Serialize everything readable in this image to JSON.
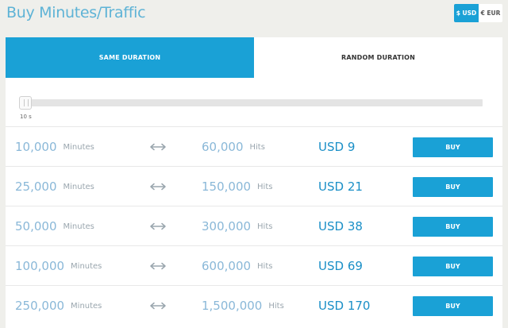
{
  "header": {
    "title": "Buy Minutes/Traffic"
  },
  "currency": {
    "usd_label": "$ USD",
    "eur_label": "€ EUR",
    "selected": "USD"
  },
  "tabs": [
    {
      "label": "SAME DURATION",
      "active": true
    },
    {
      "label": "RANDOM DURATION",
      "active": false
    }
  ],
  "slider": {
    "value_label": "10 s",
    "value": 10
  },
  "colors": {
    "accent": "#1aa1d6",
    "number": "#8ab8d8",
    "price": "#1a8fc7"
  },
  "rows": [
    {
      "minutes": "10,000",
      "minutes_unit": "Minutes",
      "hits": "60,000",
      "hits_unit": "Hits",
      "price": "USD 9",
      "buy_label": "BUY"
    },
    {
      "minutes": "25,000",
      "minutes_unit": "Minutes",
      "hits": "150,000",
      "hits_unit": "Hits",
      "price": "USD 21",
      "buy_label": "BUY"
    },
    {
      "minutes": "50,000",
      "minutes_unit": "Minutes",
      "hits": "300,000",
      "hits_unit": "Hits",
      "price": "USD 38",
      "buy_label": "BUY"
    },
    {
      "minutes": "100,000",
      "minutes_unit": "Minutes",
      "hits": "600,000",
      "hits_unit": "Hits",
      "price": "USD 69",
      "buy_label": "BUY"
    },
    {
      "minutes": "250,000",
      "minutes_unit": "Minutes",
      "hits": "1,500,000",
      "hits_unit": "Hits",
      "price": "USD 170",
      "buy_label": "BUY"
    }
  ]
}
